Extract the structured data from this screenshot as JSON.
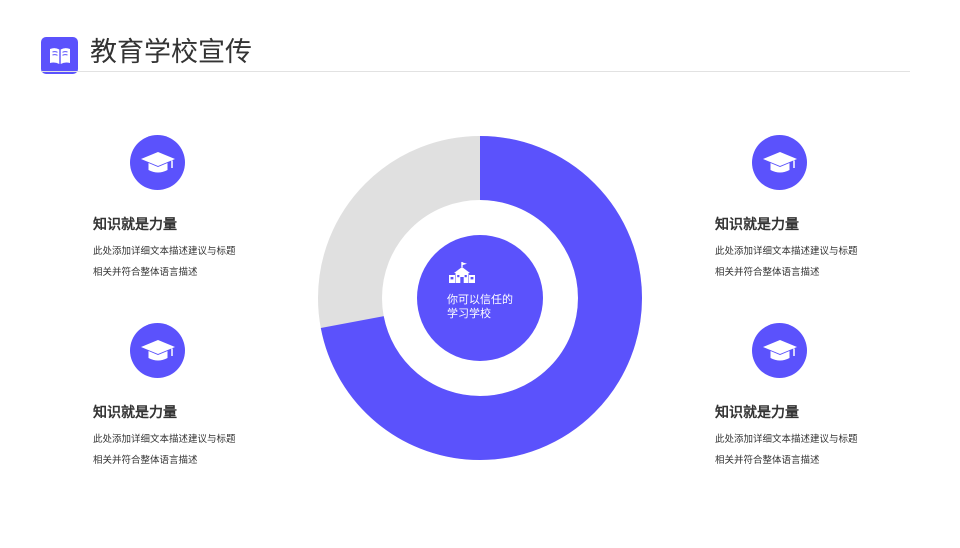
{
  "header": {
    "title": "教育学校宣传",
    "logo_icon": "book-icon"
  },
  "accent_color": "#5b52fc",
  "features": [
    {
      "icon": "graduation-cap-icon",
      "title": "知识就是力量",
      "desc_line1": "此处添加详细文本描述建议与标题",
      "desc_line2": "相关并符合整体语言描述"
    },
    {
      "icon": "graduation-cap-icon",
      "title": "知识就是力量",
      "desc_line1": "此处添加详细文本描述建议与标题",
      "desc_line2": "相关并符合整体语言描述"
    },
    {
      "icon": "graduation-cap-icon",
      "title": "知识就是力量",
      "desc_line1": "此处添加详细文本描述建议与标题",
      "desc_line2": "相关并符合整体语言描述"
    },
    {
      "icon": "graduation-cap-icon",
      "title": "知识就是力量",
      "desc_line1": "此处添加详细文本描述建议与标题",
      "desc_line2": "相关并符合整体语言描述"
    }
  ],
  "donut": {
    "highlight_fraction": 0.72,
    "highlight_color": "#5b52fc",
    "rest_color": "#e0e0e0",
    "center_icon": "school-building-icon",
    "center_line1": "你可以信任的",
    "center_line2": "学习学校"
  }
}
